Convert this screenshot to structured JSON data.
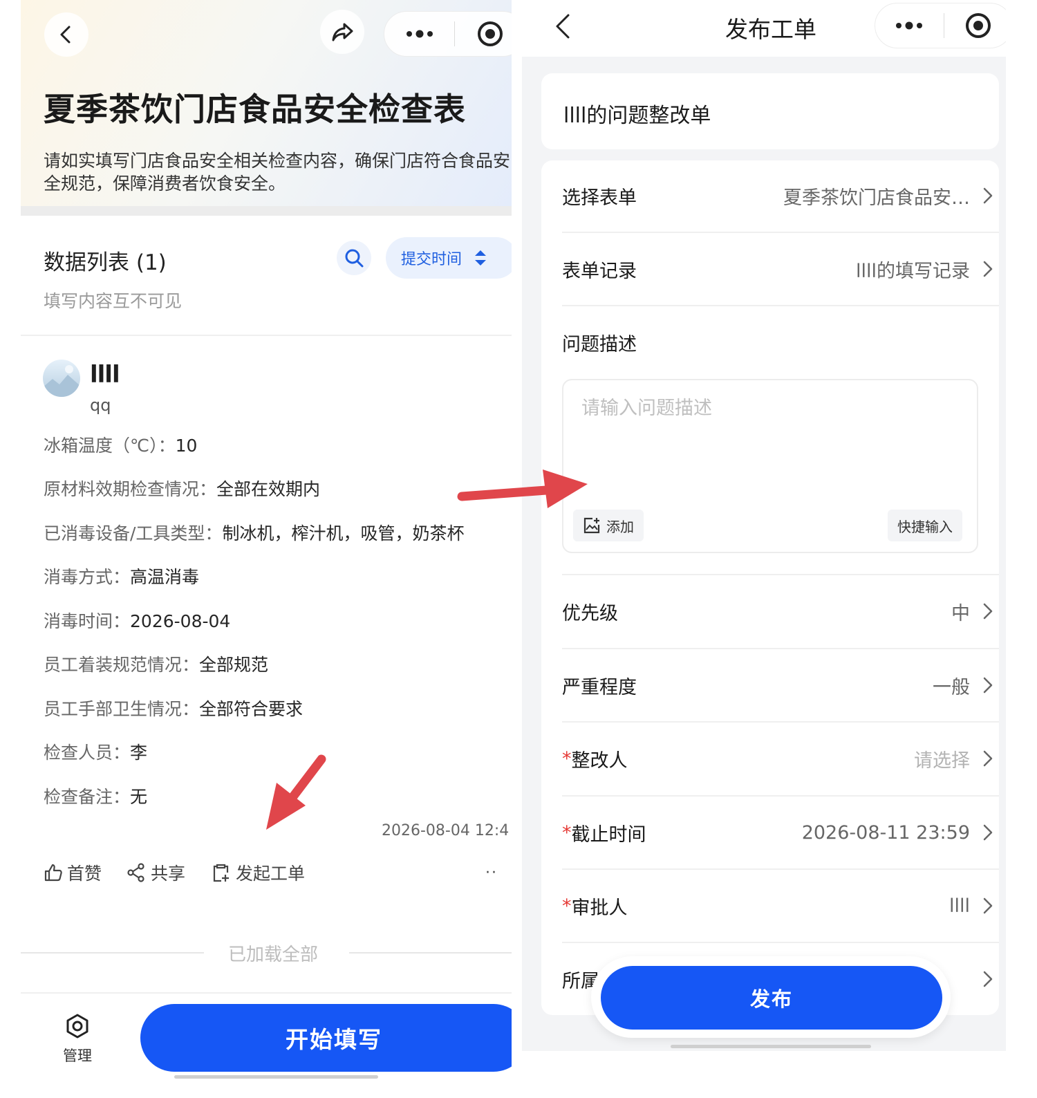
{
  "left": {
    "nav": {
      "back": "back-icon",
      "share": "share-icon",
      "more": "more-icon",
      "record": "record-icon"
    },
    "title": "夏季茶饮门店食品安全检查表",
    "description": "请如实填写门店食品安全相关检查内容，确保门店符合食品安全规范，保障消费者饮食安全。",
    "list_title": "数据列表 (1)",
    "list_subtitle": "填写内容互不可见",
    "sort_label": "提交时间",
    "entry": {
      "user_name": "llll",
      "user_sub": "qq",
      "fields": [
        {
          "key": "冰箱温度（℃）：",
          "value": "10"
        },
        {
          "key": "原材料效期检查情况：",
          "value": "全部在效期内"
        },
        {
          "key": "已消毒设备/工具类型：",
          "value": "制冰机，榨汁机，吸管，奶茶杯"
        },
        {
          "key": "消毒方式：",
          "value": "高温消毒"
        },
        {
          "key": "消毒时间：",
          "value": "2026-08-04"
        },
        {
          "key": "员工着装规范情况：",
          "value": "全部规范"
        },
        {
          "key": "员工手部卫生情况：",
          "value": "全部符合要求"
        },
        {
          "key": "检查人员：",
          "value": "李"
        },
        {
          "key": "检查备注：",
          "value": "无"
        }
      ],
      "timestamp": "2026-08-04 12:4",
      "actions": {
        "like": "首赞",
        "share": "共享",
        "create_ticket": "发起工单",
        "more": "··"
      }
    },
    "loaded_text": "已加载全部",
    "manage_label": "管理",
    "start_label": "开始填写"
  },
  "right": {
    "title": "发布工单",
    "form_name": "llll的问题整改单",
    "rows": {
      "form": {
        "label": "选择表单",
        "value": "夏季茶饮门店食品安…"
      },
      "record": {
        "label": "表单记录",
        "value": "llll的填写记录"
      },
      "desc_label": "问题描述",
      "desc_placeholder": "请输入问题描述",
      "add_label": "添加",
      "quick_label": "快捷输入",
      "priority": {
        "label": "优先级",
        "value": "中"
      },
      "severity": {
        "label": "严重程度",
        "value": "一般"
      },
      "assignee": {
        "req": "*",
        "label": "整改人",
        "value": "请选择"
      },
      "deadline": {
        "req": "*",
        "label": "截止时间",
        "value": "2026-08-11 23:59"
      },
      "approver": {
        "req": "*",
        "label": "审批人",
        "value": "llll"
      },
      "belong": {
        "label": "所属"
      }
    },
    "publish_label": "发布"
  },
  "colors": {
    "primary": "#1657f5",
    "arrow": "#e0464b",
    "required": "#e53935"
  }
}
